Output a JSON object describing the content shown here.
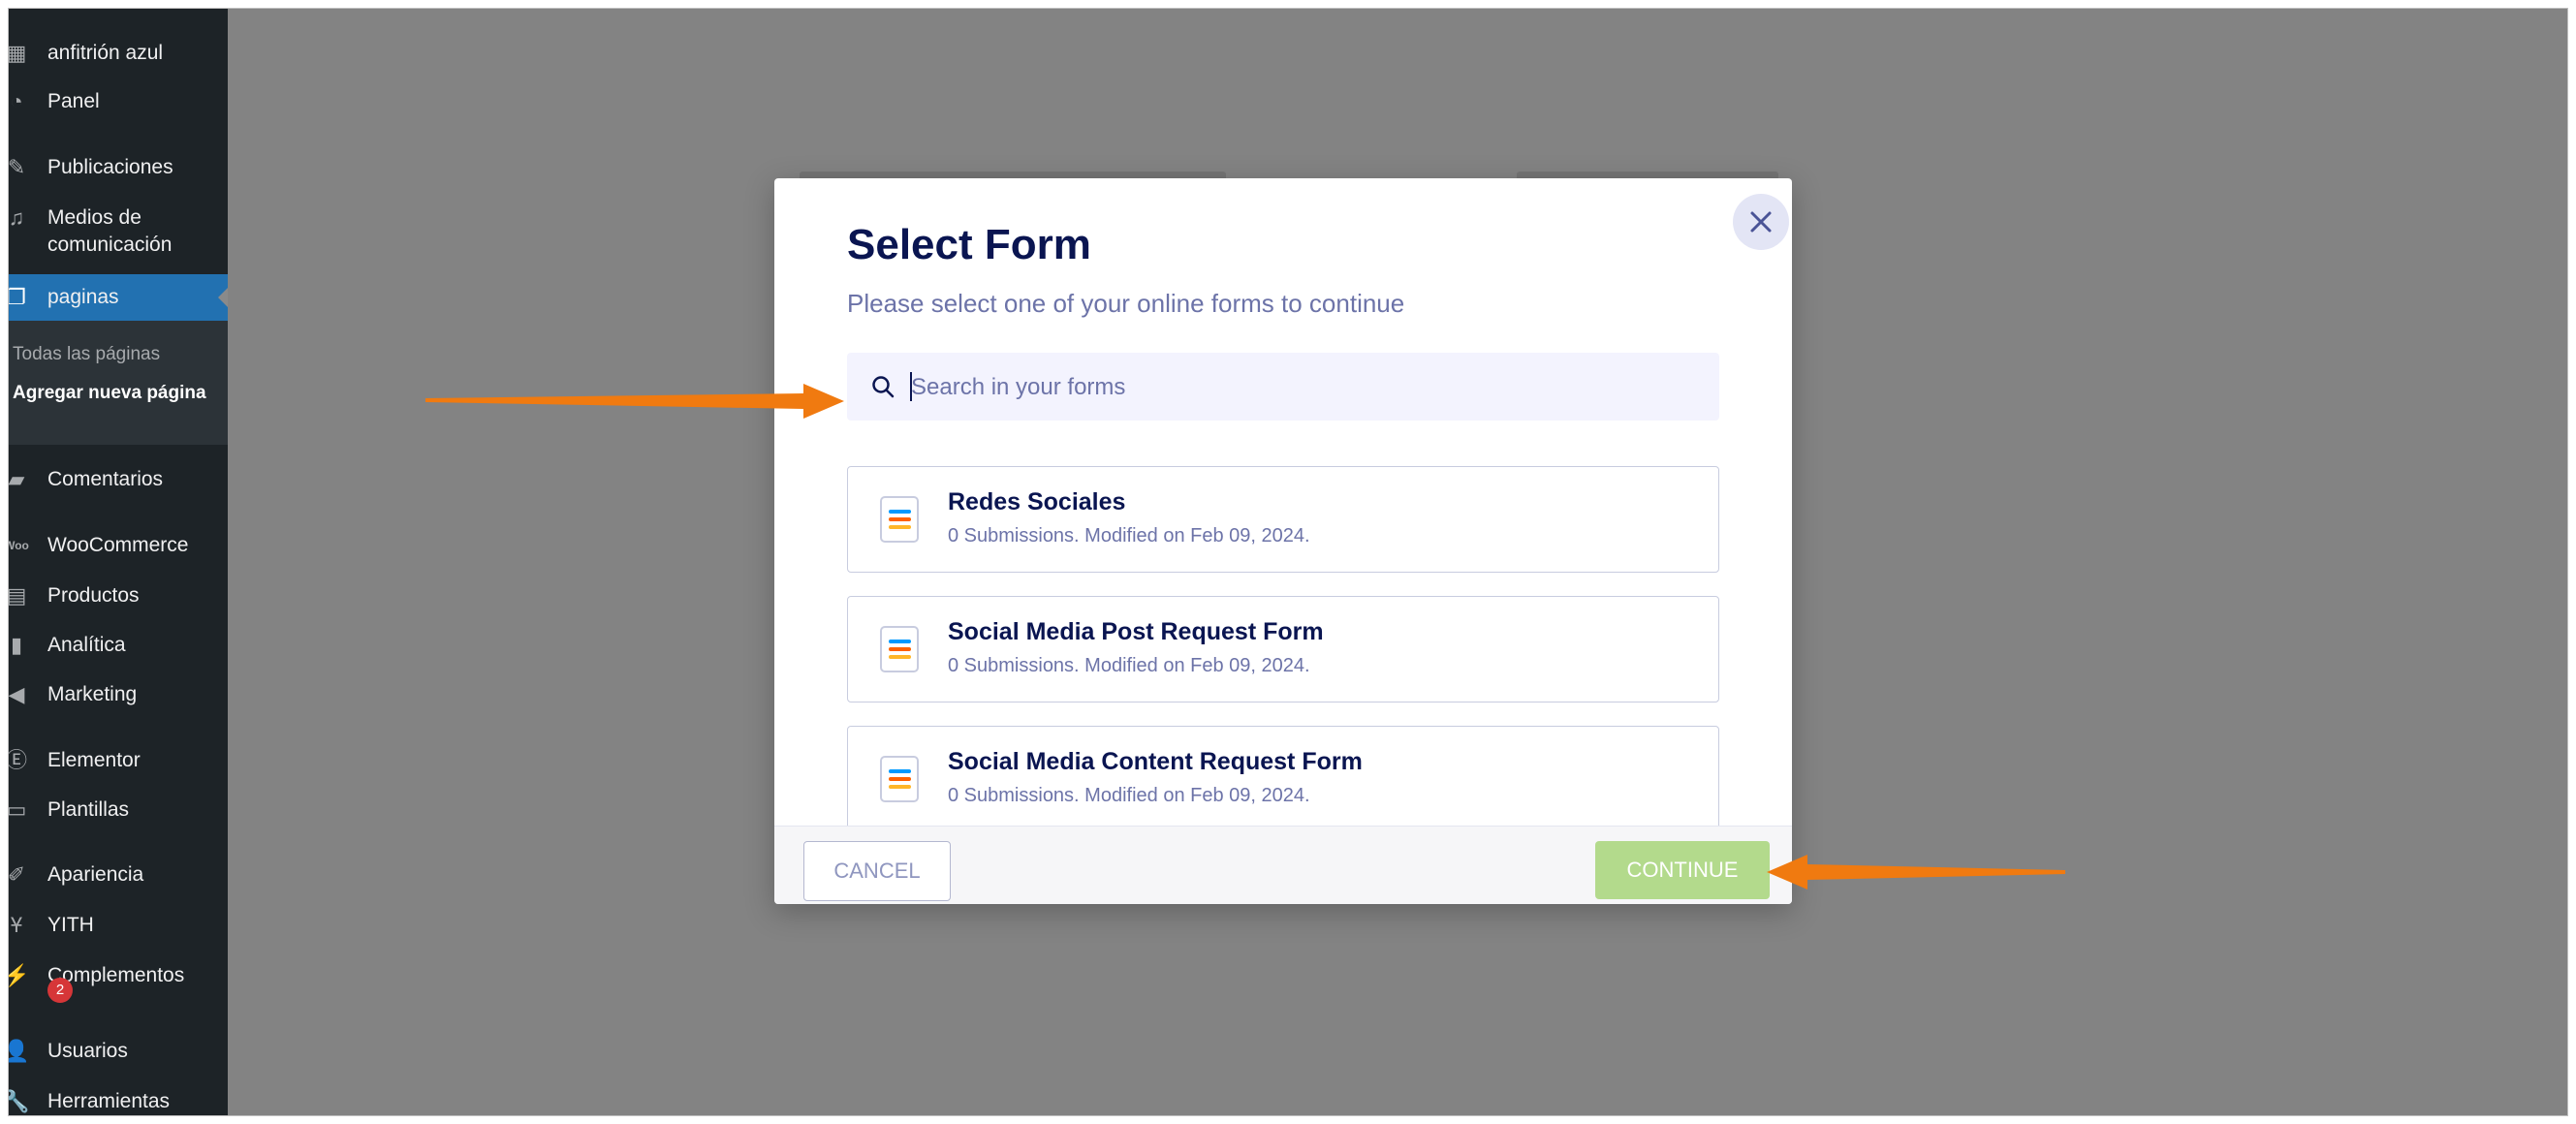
{
  "sidebar": {
    "site_name": "anfitrión azul",
    "items": [
      {
        "label": "Panel",
        "icon": "dashboard-icon"
      },
      {
        "label": "Publicaciones",
        "icon": "pin-icon"
      },
      {
        "label": "Medios de comunicación",
        "icon": "media-icon"
      },
      {
        "label": "paginas",
        "icon": "pages-icon"
      },
      {
        "label": "Comentarios",
        "icon": "comments-icon"
      },
      {
        "label": "WooCommerce",
        "icon": "woocommerce-icon"
      },
      {
        "label": "Productos",
        "icon": "products-icon"
      },
      {
        "label": "Analítica",
        "icon": "analytics-icon"
      },
      {
        "label": "Marketing",
        "icon": "megaphone-icon"
      },
      {
        "label": "Elementor",
        "icon": "elementor-icon"
      },
      {
        "label": "Plantillas",
        "icon": "folder-icon"
      },
      {
        "label": "Apariencia",
        "icon": "brush-icon"
      },
      {
        "label": "YITH",
        "icon": "yith-icon"
      },
      {
        "label": "Complementos",
        "icon": "plugin-icon",
        "badge": "2"
      },
      {
        "label": "Usuarios",
        "icon": "users-icon"
      },
      {
        "label": "Herramientas",
        "icon": "wrench-icon"
      }
    ],
    "submenu": {
      "all_pages": "Todas las páginas",
      "add_new": "Agregar nueva página"
    }
  },
  "modal": {
    "title": "Select Form",
    "subtitle": "Please select one of your online forms to continue",
    "search_placeholder": "Search in your forms",
    "forms": [
      {
        "name": "Redes Sociales",
        "meta": "0 Submissions. Modified on Feb 09, 2024."
      },
      {
        "name": "Social Media Post Request Form",
        "meta": "0 Submissions. Modified on Feb 09, 2024."
      },
      {
        "name": "Social Media Content Request Form",
        "meta": "0 Submissions. Modified on Feb 09, 2024."
      }
    ],
    "cancel_label": "CANCEL",
    "continue_label": "CONTINUE"
  },
  "colors": {
    "sidebar_bg": "#1d2327",
    "active_item": "#2271b1",
    "overlay": "#838383",
    "title": "#0a1551",
    "continue_button": "#b3da8c",
    "arrow": "#f07a10"
  }
}
